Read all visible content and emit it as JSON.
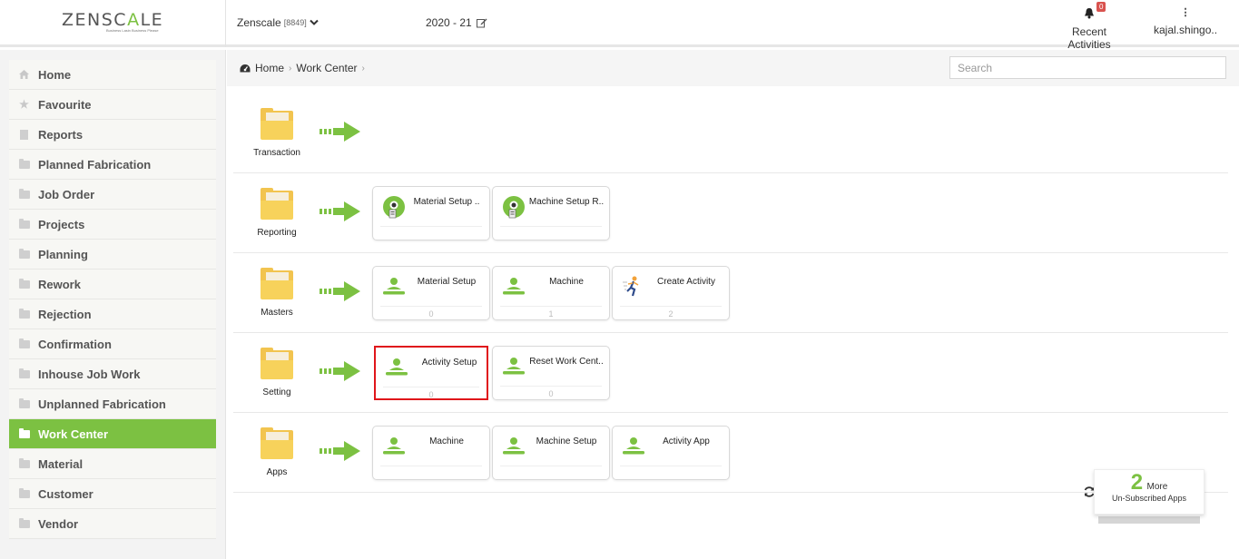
{
  "header": {
    "logo_pre": "ZENSC",
    "logo_accent": "A",
    "logo_post": "LE",
    "tagline": "Business Lasin Business Please",
    "company_name": "Zenscale",
    "company_code": "[8849]",
    "year": "2020 - 21",
    "notification_count": "0",
    "recent_activities": "Recent Activities",
    "user": "kajal.shingo.."
  },
  "sidebar": {
    "items": [
      {
        "label": "Home",
        "icon": "home-icon"
      },
      {
        "label": "Favourite",
        "icon": "star-icon"
      },
      {
        "label": "Reports",
        "icon": "file-icon"
      },
      {
        "label": "Planned Fabrication",
        "icon": "folder-icon"
      },
      {
        "label": "Job Order",
        "icon": "folder-icon"
      },
      {
        "label": "Projects",
        "icon": "folder-icon"
      },
      {
        "label": "Planning",
        "icon": "folder-icon"
      },
      {
        "label": "Rework",
        "icon": "folder-icon"
      },
      {
        "label": "Rejection",
        "icon": "folder-icon"
      },
      {
        "label": "Confirmation",
        "icon": "folder-icon"
      },
      {
        "label": "Inhouse Job Work",
        "icon": "folder-icon"
      },
      {
        "label": "Unplanned Fabrication",
        "icon": "folder-icon"
      },
      {
        "label": "Work Center",
        "icon": "folder-icon",
        "active": true
      },
      {
        "label": "Material",
        "icon": "folder-icon"
      },
      {
        "label": "Customer",
        "icon": "folder-icon"
      },
      {
        "label": "Vendor",
        "icon": "folder-icon"
      }
    ]
  },
  "breadcrumb": {
    "home": "Home",
    "current": "Work Center"
  },
  "search": {
    "placeholder": "Search"
  },
  "sections": [
    {
      "label": "Transaction",
      "cards": []
    },
    {
      "label": "Reporting",
      "cards": [
        {
          "title": "Material Setup ..",
          "icon": "report-person-icon",
          "count": ""
        },
        {
          "title": "Machine Setup R..",
          "icon": "report-person-icon",
          "count": ""
        }
      ]
    },
    {
      "label": "Masters",
      "cards": [
        {
          "title": "Material Setup",
          "icon": "person-icon",
          "count": "0"
        },
        {
          "title": "Machine",
          "icon": "person-icon",
          "count": "1"
        },
        {
          "title": "Create Activity",
          "icon": "runner-icon",
          "count": "2"
        }
      ]
    },
    {
      "label": "Setting",
      "cards": [
        {
          "title": "Activity Setup",
          "icon": "person-icon",
          "count": "0",
          "highlighted": true
        },
        {
          "title": "Reset Work Cent..",
          "icon": "person-icon",
          "count": "0"
        }
      ]
    },
    {
      "label": "Apps",
      "cards": [
        {
          "title": "Machine",
          "icon": "person-icon",
          "count": ""
        },
        {
          "title": "Machine Setup",
          "icon": "person-icon",
          "count": ""
        },
        {
          "title": "Activity App",
          "icon": "person-icon",
          "count": ""
        }
      ]
    }
  ],
  "more_apps": {
    "count": "2",
    "label": "More",
    "sublabel": "Un-Subscribed Apps"
  },
  "colors": {
    "accent": "#7cc142",
    "highlight": "#e0161b",
    "folder": "#f2c44f"
  }
}
